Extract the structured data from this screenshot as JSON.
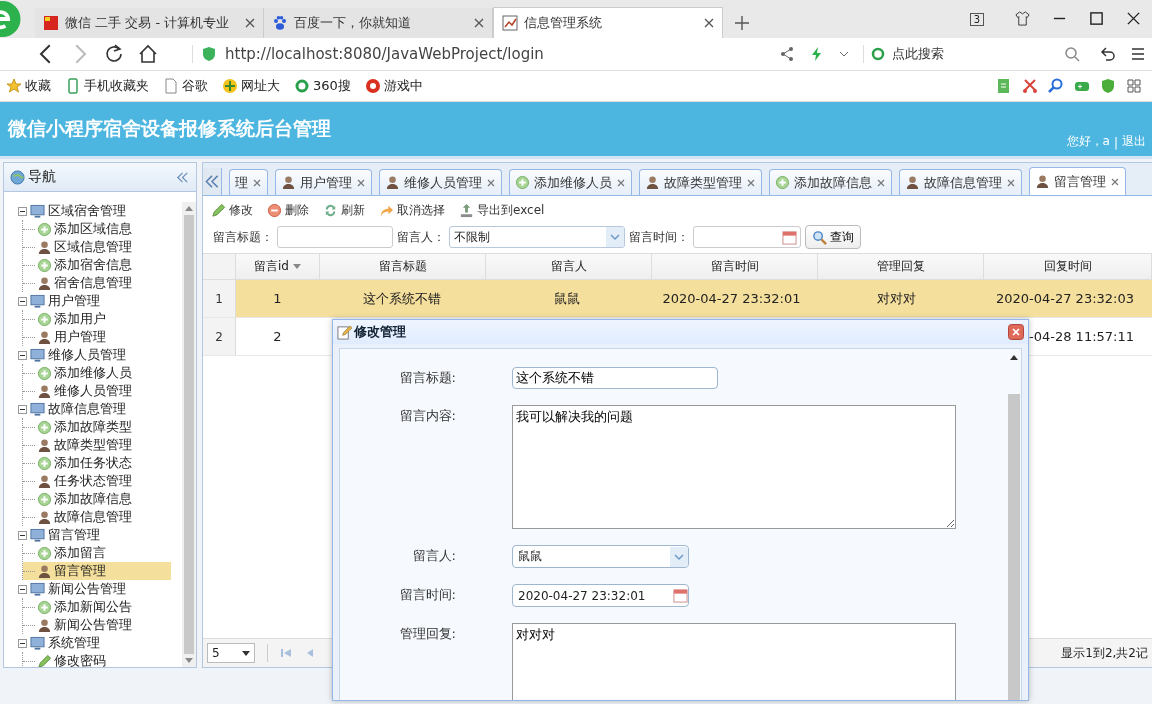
{
  "browser": {
    "tabs": [
      {
        "title": "微信 二手 交易 - 计算机专业",
        "kind": "weixin",
        "selected": false
      },
      {
        "title": "百度一下，你就知道",
        "kind": "baidu",
        "selected": false
      },
      {
        "title": "信息管理系统",
        "kind": "chart",
        "selected": true
      }
    ],
    "tab_count": "3",
    "address": "http://localhost:8080/JavaWebProject/login",
    "search_placeholder": "点此搜索",
    "bookmarks": [
      {
        "label": "收藏",
        "kind": "star"
      },
      {
        "label": "手机收藏夹",
        "kind": "phone"
      },
      {
        "label": "谷歌",
        "kind": "page"
      },
      {
        "label": "网址大",
        "kind": "site"
      },
      {
        "label": "360搜",
        "kind": "search"
      },
      {
        "label": "游戏中",
        "kind": "game"
      }
    ]
  },
  "header": {
    "title": "微信小程序宿舍设备报修系统后台管理",
    "greeting": "您好，a",
    "separator": "|",
    "logout": "退出"
  },
  "nav": {
    "title": "导航",
    "groups": [
      {
        "label": "区域宿舍管理",
        "expanded": true,
        "children": [
          {
            "label": "添加区域信息",
            "kind": "add",
            "selected": false
          },
          {
            "label": "区域信息管理",
            "kind": "user",
            "selected": false
          },
          {
            "label": "添加宿舍信息",
            "kind": "add",
            "selected": false
          },
          {
            "label": "宿舍信息管理",
            "kind": "user",
            "selected": false
          }
        ]
      },
      {
        "label": "用户管理",
        "expanded": true,
        "children": [
          {
            "label": "添加用户",
            "kind": "add",
            "selected": false
          },
          {
            "label": "用户管理",
            "kind": "user",
            "selected": false
          }
        ]
      },
      {
        "label": "维修人员管理",
        "expanded": true,
        "children": [
          {
            "label": "添加维修人员",
            "kind": "add",
            "selected": false
          },
          {
            "label": "维修人员管理",
            "kind": "user",
            "selected": false
          }
        ]
      },
      {
        "label": "故障信息管理",
        "expanded": true,
        "children": [
          {
            "label": "添加故障类型",
            "kind": "add",
            "selected": false
          },
          {
            "label": "故障类型管理",
            "kind": "user",
            "selected": false
          },
          {
            "label": "添加任务状态",
            "kind": "add",
            "selected": false
          },
          {
            "label": "任务状态管理",
            "kind": "user",
            "selected": false
          },
          {
            "label": "添加故障信息",
            "kind": "add",
            "selected": false
          },
          {
            "label": "故障信息管理",
            "kind": "user",
            "selected": false
          }
        ]
      },
      {
        "label": "留言管理",
        "expanded": true,
        "children": [
          {
            "label": "添加留言",
            "kind": "add",
            "selected": false
          },
          {
            "label": "留言管理",
            "kind": "user",
            "selected": true
          }
        ]
      },
      {
        "label": "新闻公告管理",
        "expanded": true,
        "children": [
          {
            "label": "添加新闻公告",
            "kind": "add",
            "selected": false
          },
          {
            "label": "新闻公告管理",
            "kind": "user",
            "selected": false
          }
        ]
      },
      {
        "label": "系统管理",
        "expanded": true,
        "children": [
          {
            "label": "修改密码",
            "kind": "edit",
            "selected": false
          }
        ]
      }
    ]
  },
  "main_tabs": [
    {
      "label": "理",
      "kind": "none",
      "selected": false
    },
    {
      "label": "用户管理",
      "kind": "user",
      "selected": false
    },
    {
      "label": "维修人员管理",
      "kind": "user",
      "selected": false
    },
    {
      "label": "添加维修人员",
      "kind": "add",
      "selected": false
    },
    {
      "label": "故障类型管理",
      "kind": "user",
      "selected": false
    },
    {
      "label": "添加故障信息",
      "kind": "add",
      "selected": false
    },
    {
      "label": "故障信息管理",
      "kind": "user",
      "selected": false
    },
    {
      "label": "留言管理",
      "kind": "user",
      "selected": true
    }
  ],
  "toolbar": [
    {
      "label": "修改",
      "kind": "edit"
    },
    {
      "label": "删除",
      "kind": "delete"
    },
    {
      "label": "刷新",
      "kind": "refresh"
    },
    {
      "label": "取消选择",
      "kind": "undo"
    },
    {
      "label": "导出到excel",
      "kind": "export"
    }
  ],
  "search": {
    "title_label": "留言标题：",
    "author_label": "留言人：",
    "author_value": "不限制",
    "time_label": "留言时间：",
    "button": "查询"
  },
  "grid": {
    "columns": [
      {
        "label": "留言id",
        "sorted": true
      },
      {
        "label": "留言标题",
        "sorted": false
      },
      {
        "label": "留言人",
        "sorted": false
      },
      {
        "label": "留言时间",
        "sorted": false
      },
      {
        "label": "管理回复",
        "sorted": false
      },
      {
        "label": "回复时间",
        "sorted": false
      }
    ],
    "rows": [
      {
        "number": "1",
        "selected": true,
        "cells": [
          "1",
          "这个系统不错",
          "鼠鼠",
          "2020-04-27 23:32:01",
          "对对对",
          "2020-04-27 23:32:03"
        ]
      },
      {
        "number": "2",
        "selected": false,
        "cells": [
          "2"
        ],
        "last_cell": "-04-28 11:57:11"
      }
    ]
  },
  "pager": {
    "page_size": "5",
    "info": "显示1到2,共2记"
  },
  "dialog": {
    "title": "修改管理",
    "fields": [
      {
        "label": "留言标题:",
        "kind": "text",
        "value": "这个系统不错"
      },
      {
        "label": "留言内容:",
        "kind": "textarea",
        "value": "我可以解决我的问题"
      },
      {
        "label": "留言人:",
        "kind": "select",
        "value": "鼠鼠"
      },
      {
        "label": "留言时间:",
        "kind": "date",
        "value": "2020-04-27 23:32:01"
      },
      {
        "label": "管理回复:",
        "kind": "textarea",
        "value": "对对对"
      }
    ]
  }
}
